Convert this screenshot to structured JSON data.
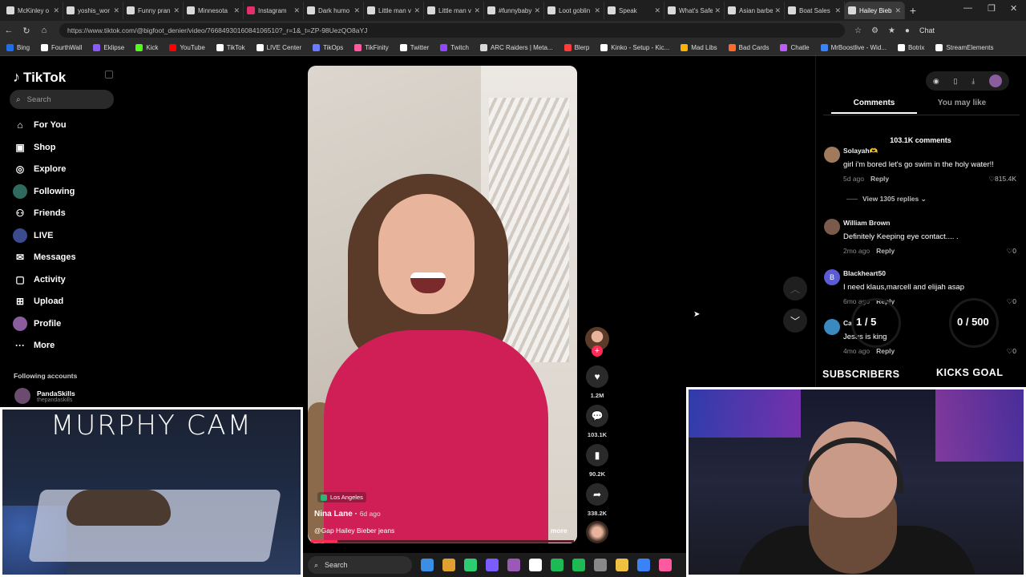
{
  "browser": {
    "tabs": [
      {
        "label": "McKinley o",
        "color": "#d9d9d9",
        "active": false
      },
      {
        "label": "yoshis_wor",
        "color": "#d9d9d9",
        "active": false
      },
      {
        "label": "Funny pran",
        "color": "#d9d9d9",
        "active": false
      },
      {
        "label": "Minnesota",
        "color": "#d9d9d9",
        "active": false
      },
      {
        "label": "Instagram",
        "color": "#e1306c",
        "active": false
      },
      {
        "label": "Dark humo",
        "color": "#d9d9d9",
        "active": false
      },
      {
        "label": "Little man v",
        "color": "#d9d9d9",
        "active": false
      },
      {
        "label": "Little man v",
        "color": "#d9d9d9",
        "active": false
      },
      {
        "label": "#funnybaby",
        "color": "#d9d9d9",
        "active": false
      },
      {
        "label": "Loot goblin",
        "color": "#d9d9d9",
        "active": false
      },
      {
        "label": "Speak",
        "color": "#d9d9d9",
        "active": false
      },
      {
        "label": "What's Safe",
        "color": "#d9d9d9",
        "active": false
      },
      {
        "label": "Asian barbe",
        "color": "#d9d9d9",
        "active": false
      },
      {
        "label": "Boat Sales",
        "color": "#d9d9d9",
        "active": false
      },
      {
        "label": "Hailey Bieb",
        "color": "#d9d9d9",
        "active": true
      }
    ],
    "new_tab": "+",
    "url": "https://www.tiktok.com/@bigfoot_denier/video/7668493016084106510?_r=1&_t=ZP-98UezQO8aYJ",
    "chat_label": "Chat",
    "bookmarks": [
      {
        "label": "Bing",
        "color": "#1f6feb"
      },
      {
        "label": "FourthWall",
        "color": "#ffffff"
      },
      {
        "label": "Eklipse",
        "color": "#8a5cf6"
      },
      {
        "label": "Kick",
        "color": "#53fc18"
      },
      {
        "label": "YouTube",
        "color": "#ff0000"
      },
      {
        "label": "TikTok",
        "color": "#ffffff"
      },
      {
        "label": "LIVE Center",
        "color": "#ffffff"
      },
      {
        "label": "TikOps",
        "color": "#6c7bff"
      },
      {
        "label": "TikFinity",
        "color": "#ff5aa0"
      },
      {
        "label": "Twitter",
        "color": "#ffffff"
      },
      {
        "label": "Twitch",
        "color": "#9146ff"
      },
      {
        "label": "ARC Raiders | Meta...",
        "color": "#d9d9d9"
      },
      {
        "label": "Blerp",
        "color": "#ff3b3b"
      },
      {
        "label": "Kinko - Setup - Kic...",
        "color": "#ffffff"
      },
      {
        "label": "Mad Libs",
        "color": "#ffb000"
      },
      {
        "label": "Bad Cards",
        "color": "#ff6a2b"
      },
      {
        "label": "Chatle",
        "color": "#c05aff"
      },
      {
        "label": "MrBoostlive - Wid...",
        "color": "#3b82f6"
      },
      {
        "label": "Botrix",
        "color": "#ffffff"
      },
      {
        "label": "StreamElements",
        "color": "#ffffff"
      }
    ]
  },
  "sidebar": {
    "logo": "TikTok",
    "search_placeholder": "Search",
    "nav": [
      {
        "label": "For You",
        "icon": "home-icon"
      },
      {
        "label": "Shop",
        "icon": "shop-icon"
      },
      {
        "label": "Explore",
        "icon": "compass-icon"
      },
      {
        "label": "Following",
        "icon": "following-avatar-icon"
      },
      {
        "label": "Friends",
        "icon": "friends-icon"
      },
      {
        "label": "LIVE",
        "icon": "live-avatar-icon"
      },
      {
        "label": "Messages",
        "icon": "messages-icon"
      },
      {
        "label": "Activity",
        "icon": "activity-icon"
      },
      {
        "label": "Upload",
        "icon": "upload-icon"
      },
      {
        "label": "Profile",
        "icon": "profile-avatar-icon"
      },
      {
        "label": "More",
        "icon": "more-icon"
      }
    ],
    "following_title": "Following accounts",
    "following": {
      "name": "PandaSkills",
      "handle": "thepandaskills"
    }
  },
  "murphy_cam": {
    "title": "MURPHY CAM"
  },
  "video": {
    "location": "Los Angeles",
    "creator": "Nina Lane",
    "date": "6d ago",
    "caption": "@Gap Hailey Bieber jeans",
    "more": "more",
    "progress": 0.1
  },
  "actions": {
    "likes": "1.2M",
    "comments": "103.1K",
    "saves": "90.2K",
    "shares": "338.2K"
  },
  "comments_panel": {
    "tab_comments": "Comments",
    "tab_you_may_like": "You may like",
    "count": "103.1K comments",
    "items": [
      {
        "user": "Solayah🫶",
        "text": "girl i'm bored let's go swim in the holy water!!",
        "time": "5d ago",
        "reply": "Reply",
        "likes": "815.4K",
        "avatar": "#a07a5a"
      },
      {
        "user": "William Brown",
        "text": "Definitely Keeping eye contact.... .",
        "time": "2mo ago",
        "reply": "Reply",
        "likes": "0",
        "avatar": "#7a5a4a"
      },
      {
        "user": "Blackheart50",
        "text": "I need klaus,marcell and elijah asap",
        "time": "6mo ago",
        "reply": "Reply",
        "likes": "0",
        "avatar": "#5b5bd6",
        "initial": "B"
      },
      {
        "user": "Cal",
        "text": "Jesus is king",
        "time": "4mo ago",
        "reply": "Reply",
        "likes": "0",
        "avatar": "#3a8ac0"
      }
    ],
    "view_replies": "View 1305 replies"
  },
  "stream_overlay": {
    "subs_count": "1 / 5",
    "subs_label": "SUBSCRIBERS",
    "kicks_count": "0 / 500",
    "kicks_label": "KICKS GOAL"
  },
  "taskbar": {
    "search": "Search",
    "apps": [
      "#3a8ee6",
      "#e0a030",
      "#2ecc71",
      "#7a5cff",
      "#9b59b6",
      "#ffffff",
      "#1db954",
      "#1db954",
      "#888888",
      "#f0c040",
      "#3b82f6",
      "#ff5aa0"
    ]
  }
}
